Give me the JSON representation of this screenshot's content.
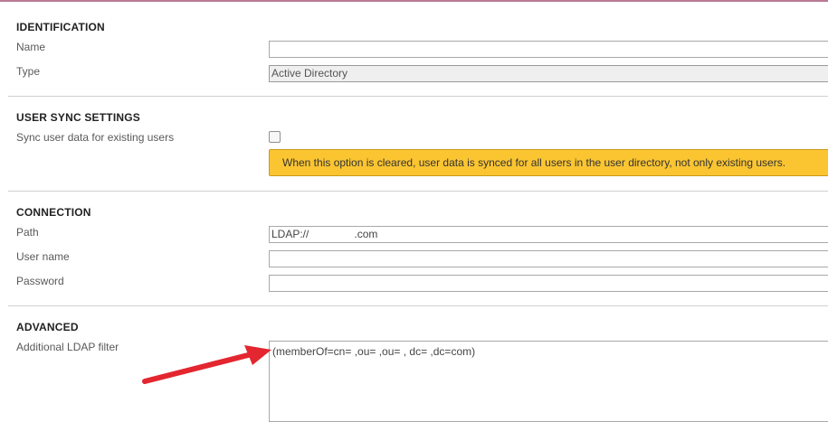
{
  "identification": {
    "title": "IDENTIFICATION",
    "name_label": "Name",
    "name_value": "",
    "type_label": "Type",
    "type_value": "Active Directory"
  },
  "user_sync": {
    "title": "USER SYNC SETTINGS",
    "sync_label": "Sync user data for existing users",
    "sync_checked": false,
    "warning_text": "When this option is cleared, user data is synced for all users in the user directory, not only existing users."
  },
  "connection": {
    "title": "CONNECTION",
    "path_label": "Path",
    "path_prefix": "LDAP://",
    "path_suffix": ".com",
    "username_label": "User name",
    "username_value": "",
    "password_label": "Password",
    "password_value": ""
  },
  "advanced": {
    "title": "ADVANCED",
    "ldap_filter_label": "Additional LDAP filter",
    "ldap_filter_value": "(memberOf=cn=                    ,ou=   ,ou=                     , dc=          ,dc=com)"
  },
  "colors": {
    "warning_bg": "#fbc531",
    "annotation_arrow": "#e3262f",
    "top_accent": "#b97a93"
  }
}
